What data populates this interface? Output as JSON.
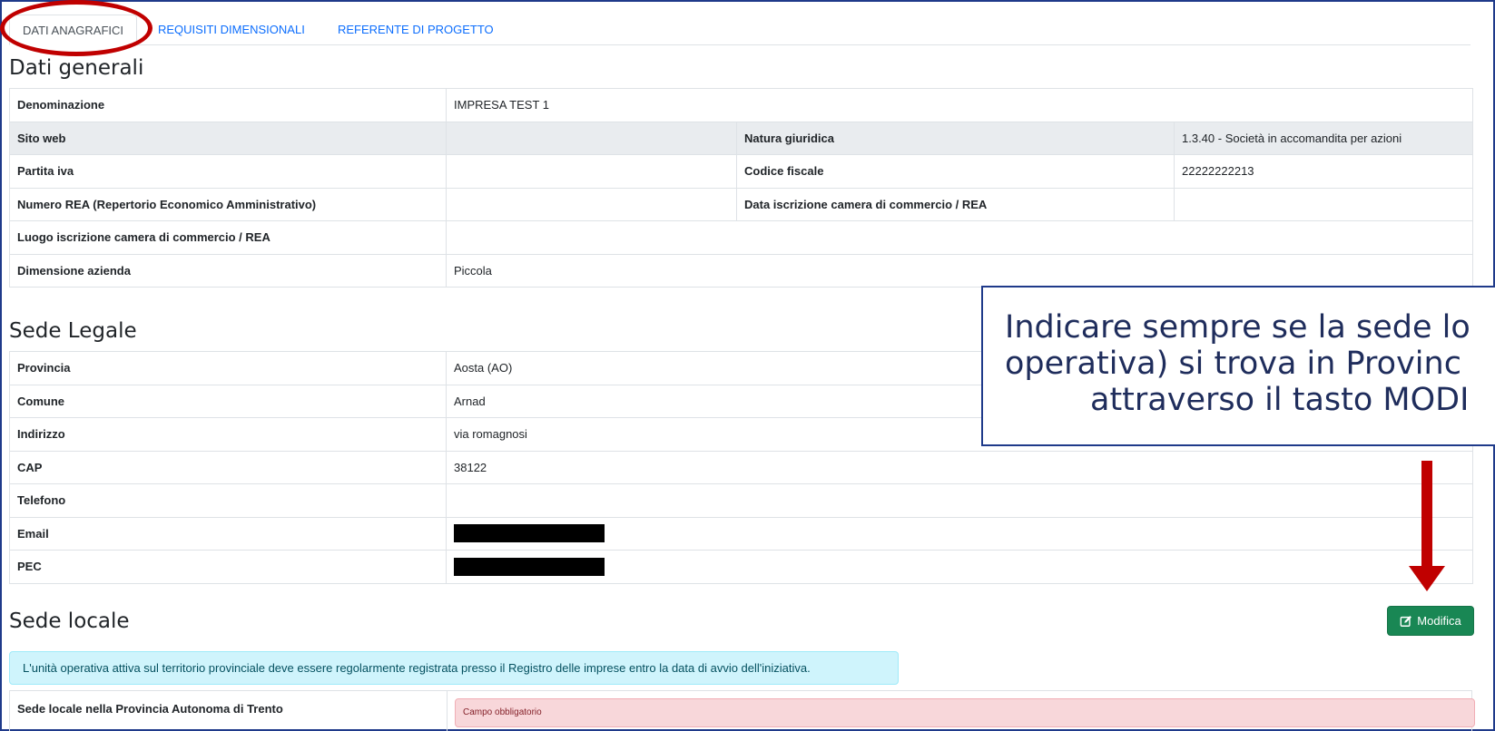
{
  "tabs": [
    {
      "label": "DATI ANAGRAFICI",
      "active": true
    },
    {
      "label": "REQUISITI DIMENSIONALI",
      "active": false
    },
    {
      "label": "REFERENTE DI PROGETTO",
      "active": false
    }
  ],
  "dati_generali": {
    "title": "Dati generali",
    "denominazione": {
      "label": "Denominazione",
      "value": "IMPRESA TEST 1"
    },
    "sito_web": {
      "label": "Sito web",
      "value": ""
    },
    "natura_giuridica": {
      "label": "Natura giuridica",
      "value": "1.3.40 - Società in accomandita per azioni"
    },
    "partita_iva": {
      "label": "Partita iva",
      "value": ""
    },
    "codice_fiscale": {
      "label": "Codice fiscale",
      "value": "22222222213"
    },
    "numero_rea": {
      "label": "Numero REA (Repertorio Economico Amministrativo)",
      "value": ""
    },
    "data_iscrizione": {
      "label": "Data iscrizione camera di commercio / REA",
      "value": ""
    },
    "luogo_iscrizione": {
      "label": "Luogo iscrizione camera di commercio / REA",
      "value": ""
    },
    "dimensione": {
      "label": "Dimensione azienda",
      "value": "Piccola"
    }
  },
  "sede_legale": {
    "title": "Sede Legale",
    "provincia": {
      "label": "Provincia",
      "value": "Aosta (AO)"
    },
    "comune": {
      "label": "Comune",
      "value": "Arnad"
    },
    "indirizzo": {
      "label": "Indirizzo",
      "value": "via romagnosi"
    },
    "cap": {
      "label": "CAP",
      "value": "38122"
    },
    "telefono": {
      "label": "Telefono",
      "value": ""
    },
    "email": {
      "label": "Email"
    },
    "pec": {
      "label": "PEC"
    }
  },
  "sede_locale": {
    "title": "Sede locale",
    "button_label": "Modifica",
    "info_text": "L'unità operativa attiva sul territorio provinciale deve essere regolarmente registrata presso il Registro delle imprese entro la data di avvio dell'iniziativa.",
    "row_label": "Sede locale nella Provincia Autonoma di Trento",
    "validation_message": "Campo obbligatorio"
  },
  "callout": {
    "line1": "Indicare sempre se la sede lo",
    "line2": "operativa) si trova in Provinc",
    "line3": "attraverso il tasto MODI"
  },
  "colors": {
    "link": "#0d6efd",
    "button_green": "#198754",
    "annotation_red": "#c00000",
    "callout_border": "#1f3a8a",
    "info_bg": "#cff4fc",
    "invalid_bg": "#f8d7da"
  },
  "icons": {
    "edit": "pencil-square-icon"
  }
}
